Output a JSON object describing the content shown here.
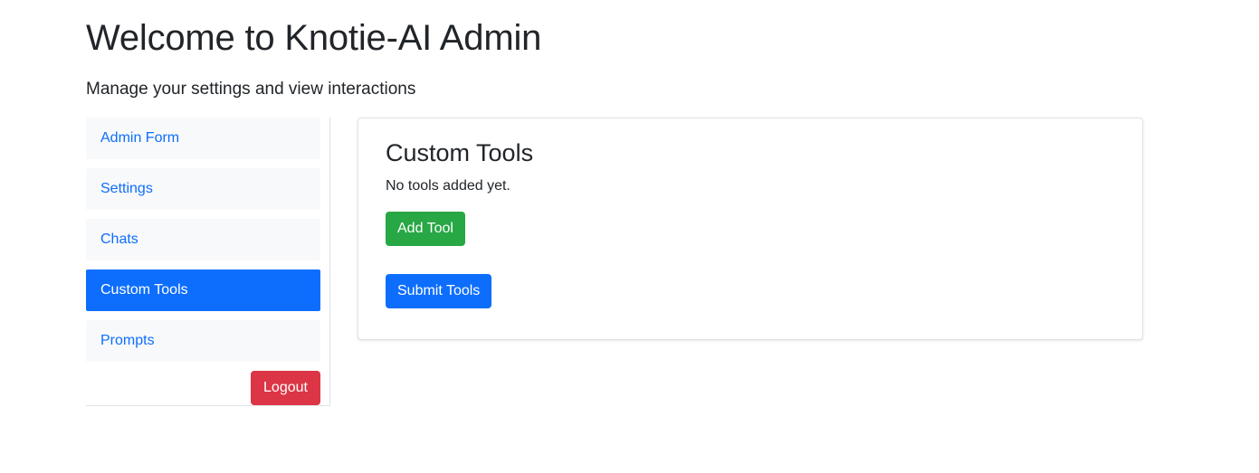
{
  "header": {
    "title": "Welcome to Knotie-AI Admin",
    "subtitle": "Manage your settings and view interactions"
  },
  "sidebar": {
    "items": [
      {
        "label": "Admin Form",
        "active": false
      },
      {
        "label": "Settings",
        "active": false
      },
      {
        "label": "Chats",
        "active": false
      },
      {
        "label": "Custom Tools",
        "active": true
      },
      {
        "label": "Prompts",
        "active": false
      }
    ],
    "logout_label": "Logout"
  },
  "main": {
    "title": "Custom Tools",
    "empty_text": "No tools added yet.",
    "add_tool_label": "Add Tool",
    "submit_tools_label": "Submit Tools"
  },
  "colors": {
    "primary": "#0d6efd",
    "success": "#28a745",
    "danger": "#dc3545",
    "nav_bg": "#f8f9fa"
  }
}
